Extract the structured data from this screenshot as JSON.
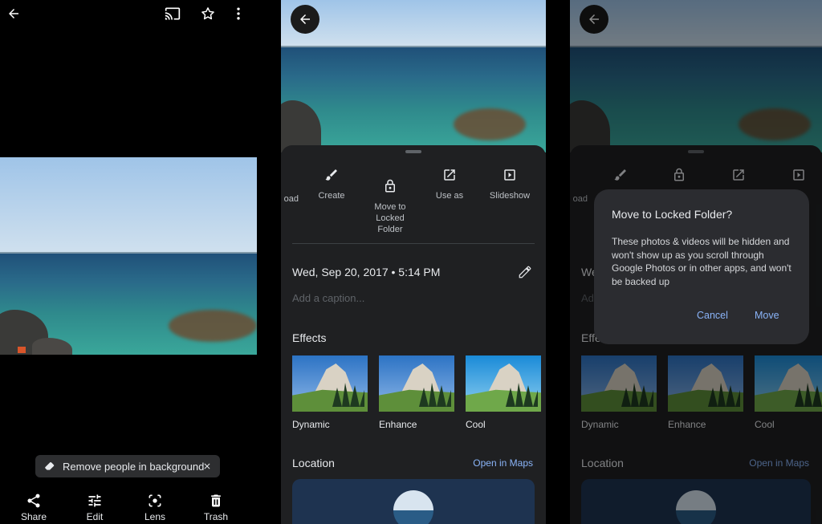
{
  "viewer": {
    "chip_label": "Remove people in background",
    "bottom_actions": [
      {
        "label": "Share",
        "icon": "share-icon"
      },
      {
        "label": "Edit",
        "icon": "sliders-icon"
      },
      {
        "label": "Lens",
        "icon": "lens-icon"
      },
      {
        "label": "Trash",
        "icon": "trash-icon"
      }
    ],
    "top_icons": [
      "back-arrow-icon",
      "cast-icon",
      "star-icon",
      "more-vert-icon"
    ]
  },
  "info": {
    "actions": [
      {
        "label": "oad",
        "icon": "download-icon"
      },
      {
        "label": "Create",
        "icon": "brush-icon"
      },
      {
        "label": "Move to\nLocked\nFolder",
        "icon": "lock-icon"
      },
      {
        "label": "Use as",
        "icon": "open-external-icon"
      },
      {
        "label": "Slideshow",
        "icon": "slideshow-icon"
      }
    ],
    "date": "Wed, Sep 20, 2017",
    "time": "5:14 PM",
    "caption_placeholder": "Add a caption...",
    "effects_title": "Effects",
    "effects": [
      "Dynamic",
      "Enhance",
      "Cool"
    ],
    "location_title": "Location",
    "open_maps": "Open in Maps"
  },
  "dialog": {
    "title": "Move to Locked Folder?",
    "body": "These photos & videos will be hidden and won't show up as you scroll through Google Photos or in other apps, and won't be backed up",
    "cancel": "Cancel",
    "move": "Move"
  },
  "colors": {
    "background": "#000000",
    "sheet": "#1f2022",
    "dialog": "#2b2c30",
    "accent": "#8ab4f8"
  }
}
